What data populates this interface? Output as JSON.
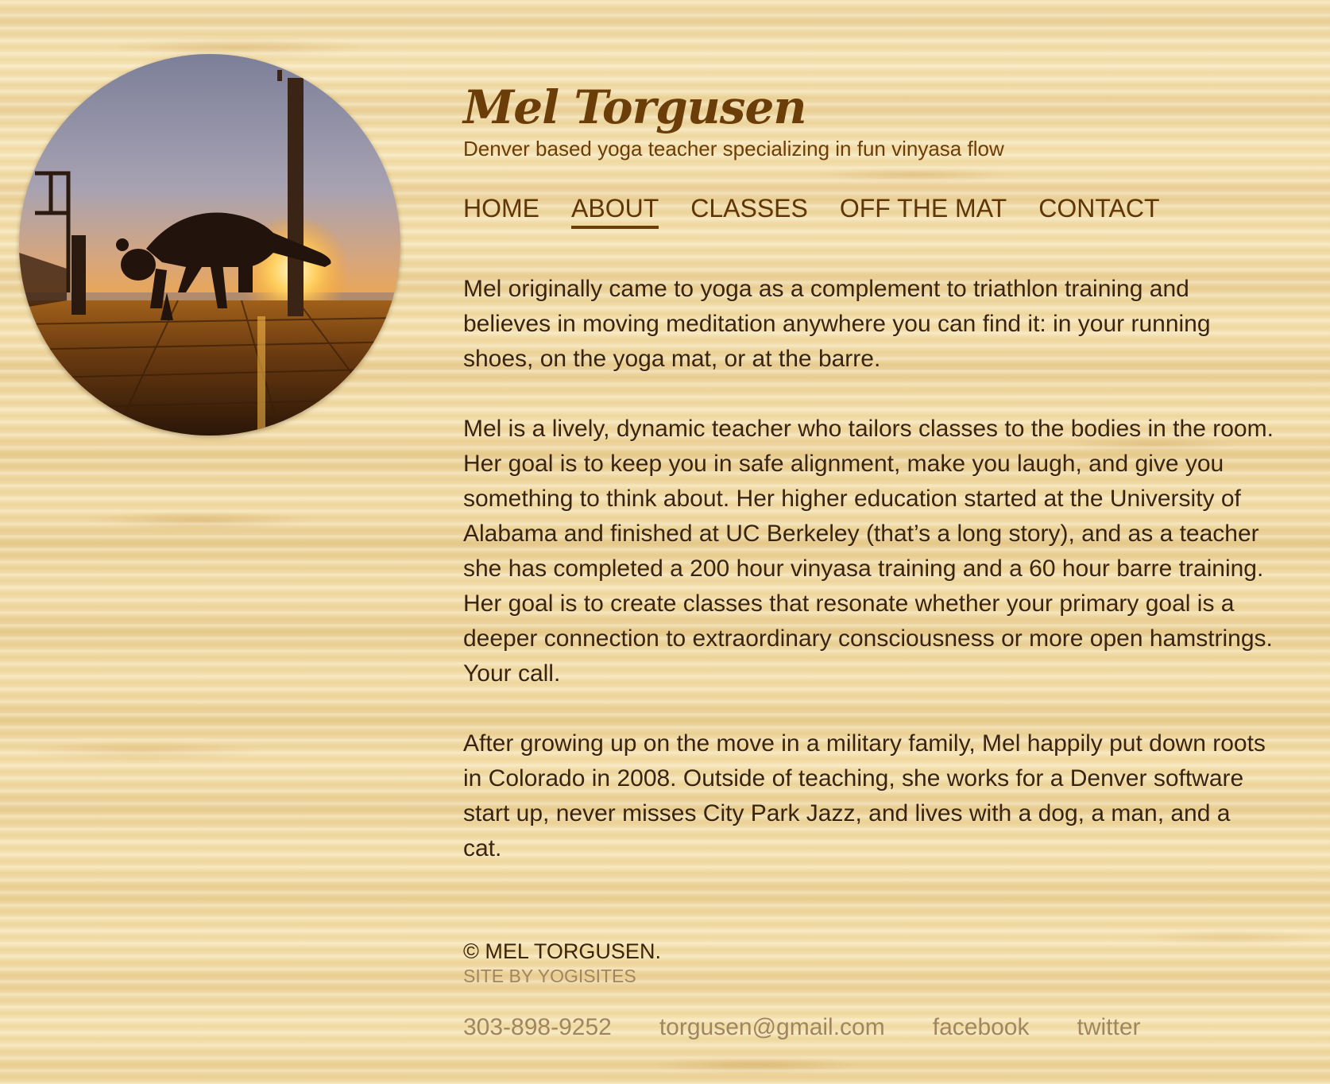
{
  "header": {
    "title": "Mel Torgusen",
    "tagline": "Denver based yoga teacher specializing in fun vinyasa flow"
  },
  "nav": {
    "items": [
      {
        "label": "HOME"
      },
      {
        "label": "ABOUT",
        "active": true
      },
      {
        "label": "CLASSES"
      },
      {
        "label": "OFF THE MAT"
      },
      {
        "label": "CONTACT"
      }
    ]
  },
  "content": {
    "paragraphs": [
      "Mel originally came to yoga as a complement to triathlon training and believes in moving meditation anywhere you can find it: in your running shoes, on the yoga mat, or at the barre.",
      "Mel is a lively, dynamic teacher who tailors classes to the bodies in the room. Her goal is to keep you in safe alignment, make you laugh, and give you something to think about. Her higher education started at the University of Alabama and finished at UC Berkeley (that’s a long story), and as a teacher she has completed a 200 hour vinyasa training and a 60 hour barre training. Her goal is to create classes that resonate whether your primary goal is a deeper connection to extraordinary consciousness or more open hamstrings. Your call.",
      "After growing up on the move in a military family, Mel  happily put down roots in Colorado in 2008. Outside of teaching, she works for a Denver software start up, never misses City Park Jazz, and lives with a dog, a man, and a cat."
    ]
  },
  "footer": {
    "copyright": "© MEL TORGUSEN.",
    "site_by": "SITE BY YOGISITES",
    "contacts": {
      "phone": "303-898-9252",
      "email": "torgusen@gmail.com",
      "facebook": "facebook",
      "twitter": "twitter"
    }
  },
  "colors": {
    "title": "#6b3d08",
    "nav": "#5e3608",
    "body_text": "#3a2410",
    "footer_muted": "#a08660",
    "background": "#f1dca6"
  },
  "photo": {
    "icon": "yoga-sunset-photo"
  }
}
